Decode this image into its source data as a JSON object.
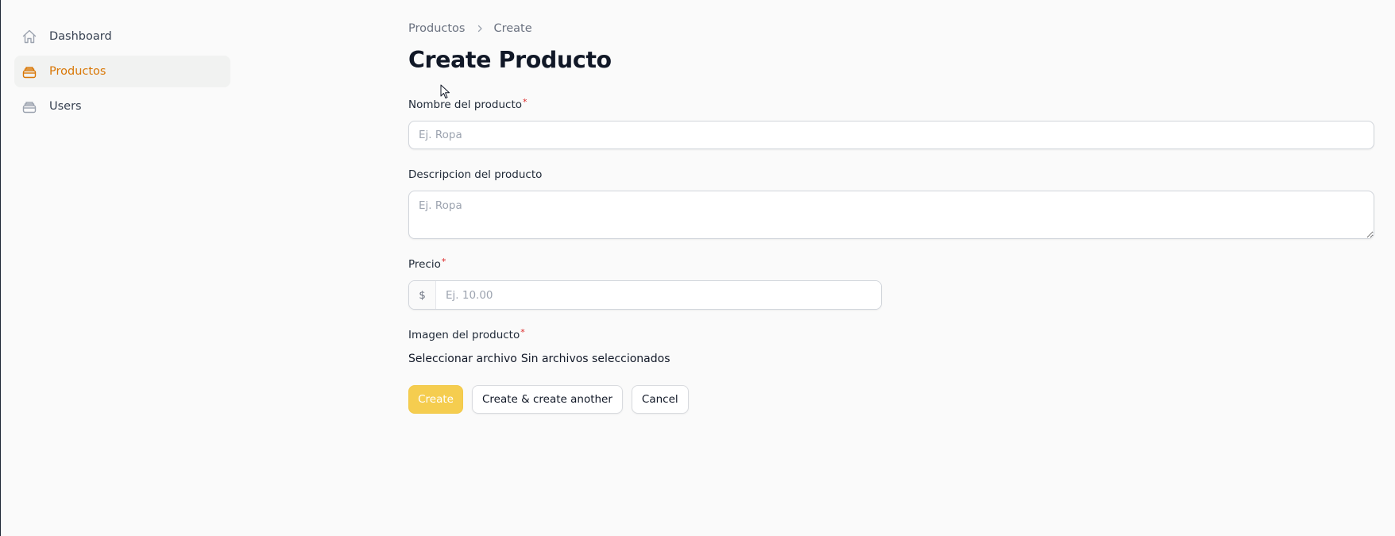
{
  "sidebar": {
    "items": [
      {
        "label": "Dashboard",
        "icon": "home-icon",
        "active": false
      },
      {
        "label": "Productos",
        "icon": "stack-icon",
        "active": true
      },
      {
        "label": "Users",
        "icon": "stack-icon",
        "active": false
      }
    ]
  },
  "breadcrumb": {
    "items": [
      "Productos",
      "Create"
    ]
  },
  "page": {
    "title": "Create Producto"
  },
  "form": {
    "nombre": {
      "label": "Nombre del producto",
      "required_mark": "*",
      "value": "",
      "placeholder": "Ej. Ropa"
    },
    "descripcion": {
      "label": "Descripcion del producto",
      "value": "",
      "placeholder": "Ej. Ropa"
    },
    "precio": {
      "label": "Precio",
      "required_mark": "*",
      "prefix": "$",
      "value": "",
      "placeholder": "Ej. 10.00"
    },
    "imagen": {
      "label": "Imagen del producto",
      "required_mark": "*",
      "button_label": "Seleccionar archivo",
      "status_text": "Sin archivos seleccionados"
    }
  },
  "actions": {
    "create_label": "Create",
    "create_another_label": "Create & create another",
    "cancel_label": "Cancel"
  },
  "colors": {
    "accent": "#d97706",
    "primary_button": "#f5cd4f",
    "required": "#dc2626",
    "background": "#fafafa"
  }
}
